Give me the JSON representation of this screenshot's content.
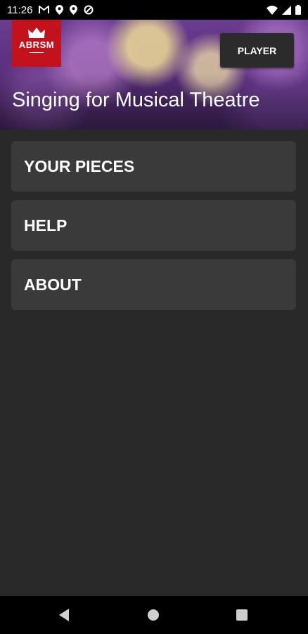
{
  "status_bar": {
    "time": "11:26",
    "left_icons": [
      "gmail-icon",
      "location-icon",
      "location-icon",
      "sync-icon"
    ],
    "right_icons": [
      "wifi-icon",
      "signal-icon",
      "battery-icon"
    ]
  },
  "header": {
    "logo_text": "ABRSM",
    "logo_color": "#c4121c",
    "player_label": "PLAYER",
    "title": "Singing for Musical Theatre"
  },
  "menu": {
    "items": [
      {
        "label": "YOUR PIECES"
      },
      {
        "label": "HELP"
      },
      {
        "label": "ABOUT"
      }
    ]
  },
  "nav_bar": {
    "buttons": [
      "back-icon",
      "home-icon",
      "recents-icon"
    ]
  }
}
